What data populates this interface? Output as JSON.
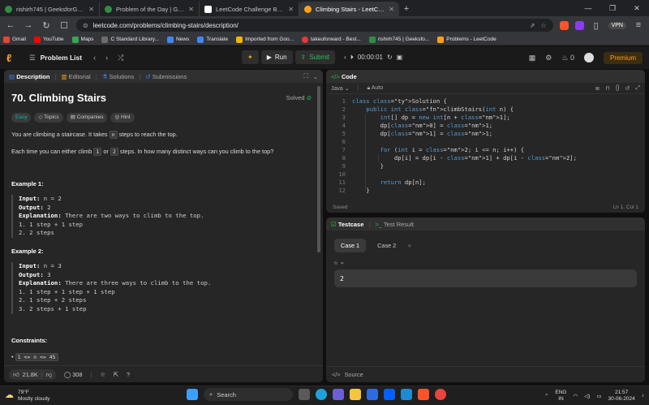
{
  "browser": {
    "tabs": [
      {
        "label": "rishirh745 | GeeksforGeeks Profile",
        "active": false,
        "color": "#2f8d46"
      },
      {
        "label": "Problem of the Day | GeeksforGeeks",
        "active": false,
        "color": "#2f8d46"
      },
      {
        "label": "LeetCode Challenge Begins!",
        "active": false,
        "color": "#ffffff"
      },
      {
        "label": "Climbing Stairs - LeetCode",
        "active": true,
        "color": "#ffa116"
      }
    ],
    "url": "leetcode.com/problems/climbing-stairs/description/",
    "vpn_label": "VPN",
    "bookmarks": [
      {
        "label": "Gmail",
        "color": "#ea4335"
      },
      {
        "label": "YouTube",
        "color": "#ff0000"
      },
      {
        "label": "Maps",
        "color": "#34a853"
      },
      {
        "label": "C Standard Library...",
        "color": "#6c6c6c"
      },
      {
        "label": "News",
        "color": "#4285f4"
      },
      {
        "label": "Translate",
        "color": "#4285f4"
      },
      {
        "label": "Imported from Goo...",
        "color": "#f4b400"
      },
      {
        "label": "takeuforward - Best...",
        "color": "#e53935"
      },
      {
        "label": "rishirh745 | Geeksfo...",
        "color": "#2f8d46"
      },
      {
        "label": "Problems - LeetCode",
        "color": "#ffa116"
      }
    ]
  },
  "lcnav": {
    "problem_list": "Problem List",
    "run": "Run",
    "submit": "Submit",
    "timer": "00:00:01",
    "fire_count": "0",
    "premium": "Premium"
  },
  "desc": {
    "tabs": [
      "Description",
      "Editorial",
      "Solutions",
      "Submissions"
    ],
    "title": "70. Climbing Stairs",
    "solved": "Solved",
    "tags": [
      "Easy",
      "Topics",
      "Companies",
      "Hint"
    ],
    "p1_a": "You are climbing a staircase. It takes",
    "p1_code": "n",
    "p1_b": "steps to reach the top.",
    "p2_a": "Each time you can either climb",
    "p2_c1": "1",
    "p2_or": "or",
    "p2_c2": "2",
    "p2_b": "steps. In how many distinct ways can you climb to the top?",
    "ex1": {
      "heading": "Example 1:",
      "input_label": "Input:",
      "input": "n = 2",
      "output_label": "Output:",
      "output": "2",
      "expl_label": "Explanation:",
      "expl": "There are two ways to climb to the top.",
      "lines": [
        "1. 1 step + 1 step",
        "2. 2 steps"
      ]
    },
    "ex2": {
      "heading": "Example 2:",
      "input_label": "Input:",
      "input": "n = 3",
      "output_label": "Output:",
      "output": "3",
      "expl_label": "Explanation:",
      "expl": "There are three ways to climb to the top.",
      "lines": [
        "1. 1 step + 1 step + 1 step",
        "2. 1 step + 2 steps",
        "3. 2 steps + 1 step"
      ]
    },
    "constraints_heading": "Constraints:",
    "constraint": "1 <= n <= 45",
    "likes": "21.8K",
    "comments": "308"
  },
  "code": {
    "tab": "Code",
    "language": "Java",
    "mode": "Auto",
    "status": "Saved",
    "cursor": "Ln 1, Col 1",
    "lines": [
      "class Solution {",
      "    public int climbStairs(int n) {",
      "        int[] dp = new int[n + 1];",
      "        dp[0] = 1;",
      "        dp[1] = 1;",
      "",
      "        for (int i = 2; i <= n; i++) {",
      "            dp[i] = dp[i - 1] + dp[i - 2];",
      "        }",
      "",
      "        return dp[n];",
      "    }"
    ]
  },
  "tests": {
    "tab_testcase": "Testcase",
    "tab_result": "Test Result",
    "cases": [
      "Case 1",
      "Case 2"
    ],
    "var_label": "n =",
    "var_value": "2",
    "source": "Source"
  },
  "taskbar": {
    "temp": "79°F",
    "weather": "Mostly cloudy",
    "search": "Search",
    "lang1": "ENG",
    "lang2": "IN",
    "time": "21:57",
    "date": "30-06-2024"
  }
}
